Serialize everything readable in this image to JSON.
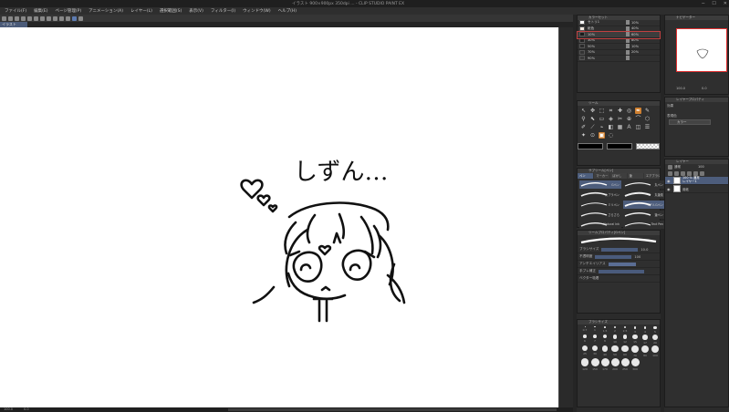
{
  "titlebar": {
    "title": "イラスト 900×900px 350dpi ... - CLIP STUDIO PAINT EX",
    "min": "─",
    "max": "☐",
    "close": "✕"
  },
  "menu": [
    "ファイル(F)",
    "編集(E)",
    "ページ管理(P)",
    "アニメーション(A)",
    "レイヤー(L)",
    "選択範囲(S)",
    "表示(V)",
    "フィルター(I)",
    "ウィンドウ(W)",
    "ヘルプ(H)"
  ],
  "doc_tab": "イラスト",
  "statusbar": {
    "zoom": "100.0",
    "angle": "0.0"
  },
  "color_set": {
    "header": "カラーセット",
    "rows": [
      {
        "name": "セトリ1",
        "pct": "10%",
        "color": "#ffffff"
      },
      {
        "name": "紙色",
        "pct": "40%",
        "color": "#f0e8e0"
      },
      {
        "name": "10%",
        "pct": "60%",
        "color": "#1a1a1a"
      },
      {
        "name": "30%",
        "pct": "80%",
        "color": "#222222"
      },
      {
        "name": "50%",
        "pct": "10%",
        "color": "#2a2a2a"
      },
      {
        "name": "70%",
        "pct": "20%",
        "color": "#333333"
      },
      {
        "name": "90%",
        "pct": "",
        "color": "#3a3a3a"
      }
    ]
  },
  "tools": {
    "header": "ツール",
    "glyphs": [
      "↖",
      "✥",
      "⬚",
      "⌗",
      "✚",
      "◎",
      "✒",
      "✎",
      "⚲",
      "⬉",
      "▭",
      "◈",
      "✂",
      "⊕",
      "⌒",
      "⬡",
      "✐",
      "⟋",
      "⌁",
      "◧",
      "▦",
      "Ａ",
      "◫",
      "☰",
      "✦",
      "⊙",
      "▣",
      "◌"
    ]
  },
  "sub_tool": {
    "header": "サブツール[ペン]",
    "tabs": [
      "ペン",
      "マーカー",
      "ぼかし",
      "筆",
      "エアブラシ"
    ],
    "brushes": [
      {
        "label": "Gペン"
      },
      {
        "label": "丸ペン"
      },
      {
        "label": "カブラペン"
      },
      {
        "label": "丸筆風"
      },
      {
        "label": "ミリペン"
      },
      {
        "label": "リアルGペン"
      },
      {
        "label": "さらさら"
      },
      {
        "label": "筆ペン"
      },
      {
        "label": "Natural Ink"
      },
      {
        "label": "Text Pen"
      }
    ]
  },
  "tool_property": {
    "header": "ツールプロパティ[Gペン]",
    "rows": [
      {
        "label": "ブラシサイズ",
        "value": "10.0"
      },
      {
        "label": "不透明度",
        "value": "100"
      },
      {
        "label": "アンチエイリアス",
        "value": ""
      },
      {
        "label": "手ブレ補正",
        "value": ""
      },
      {
        "label": "ベクター吸着",
        "value": ""
      }
    ]
  },
  "brush_size": {
    "header": "ブラシサイズ",
    "sizes": [
      "0.7",
      "1",
      "1.5",
      "2",
      "2.5",
      "3",
      "4",
      "5",
      "6",
      "7",
      "8",
      "10",
      "12",
      "15",
      "17",
      "20",
      "25",
      "30",
      "40",
      "50",
      "60",
      "70",
      "80",
      "100",
      "120",
      "150",
      "170",
      "200",
      "250",
      "300"
    ]
  },
  "navigator": {
    "header": "ナビゲーター",
    "zoom": "100.0",
    "angle": "0.0"
  },
  "layer_property": {
    "header": "レイヤープロパティ",
    "effect": "効果",
    "expression": "表現色",
    "color_mode": "カラー"
  },
  "layers": {
    "header": "レイヤー",
    "blend": "通常",
    "opacity": "100",
    "rows": [
      {
        "name": "100 % 通常\nレイヤー1",
        "selected": true
      },
      {
        "name": "用紙",
        "selected": false
      }
    ]
  },
  "drawing_text": "しずん…"
}
